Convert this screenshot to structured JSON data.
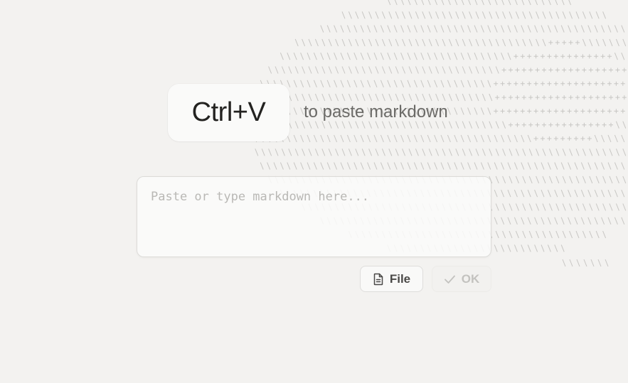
{
  "shortcut": {
    "key_label": "Ctrl+V",
    "hint": "to paste markdown"
  },
  "editor": {
    "placeholder": "Paste or type markdown here...",
    "value": ""
  },
  "actions": {
    "file_label": "File",
    "file_icon": "file-text-icon",
    "ok_label": "OK",
    "ok_icon": "check-icon",
    "ok_enabled": false
  },
  "colors": {
    "background": "#f3f2f0",
    "pattern": "#c7c6c3",
    "text_primary": "#232220",
    "text_muted": "#6b6a67",
    "disabled": "#c3c2bf"
  }
}
